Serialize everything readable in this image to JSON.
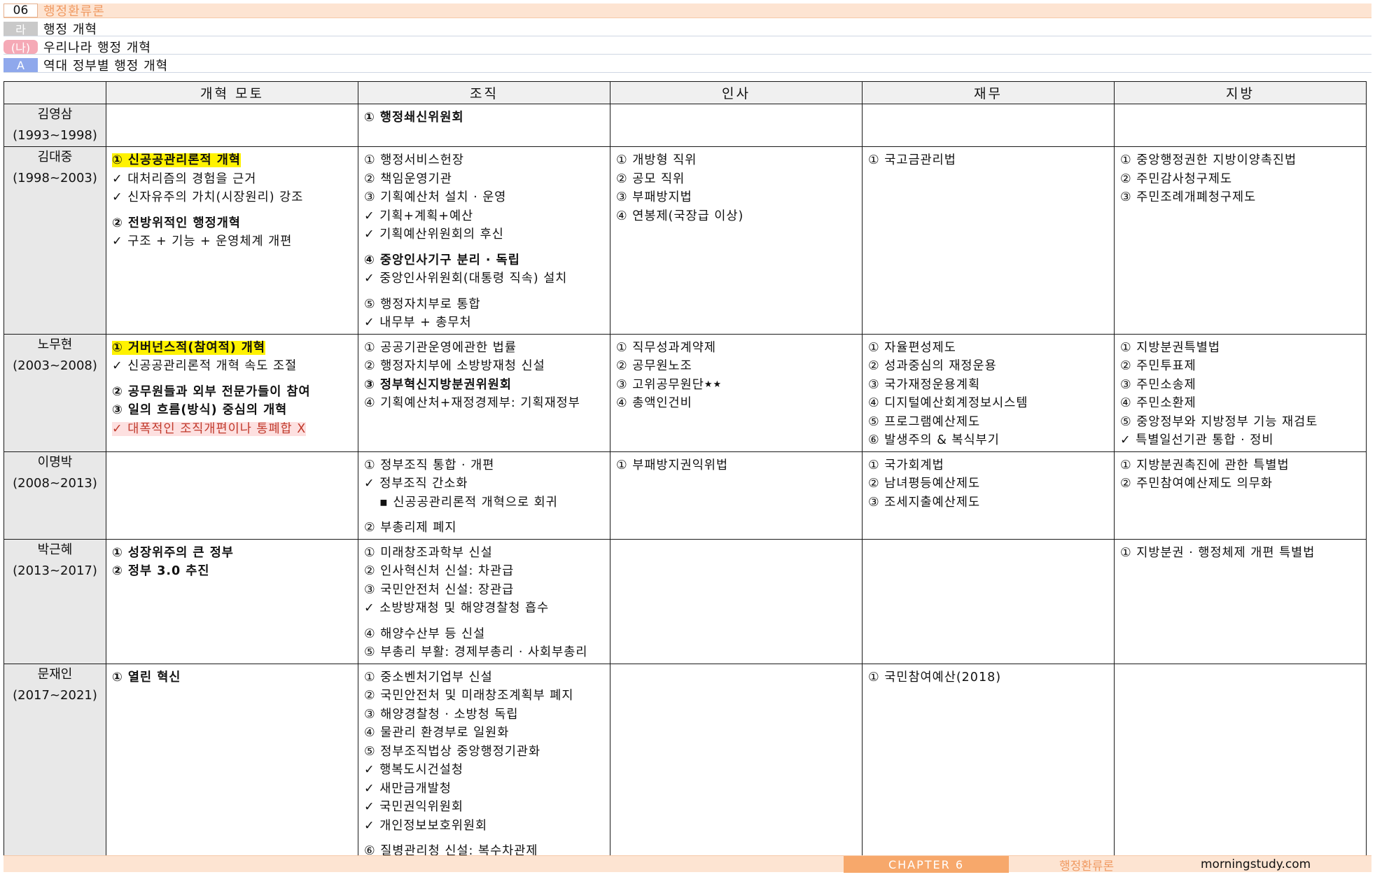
{
  "header": {
    "chapter_num": "06",
    "chapter_title": "행정환류론",
    "ra_label": "라",
    "ra_title": "행정 개혁",
    "na_label": "(나)",
    "na_title": "우리나라 행정 개혁",
    "a_label": "A",
    "a_title": "역대 정부별 행정 개혁"
  },
  "table": {
    "columns": [
      "개혁 모토",
      "조직",
      "인사",
      "재무",
      "지방"
    ],
    "rows": [
      {
        "name": "김영삼",
        "years": "(1993~1998)",
        "motto": [],
        "org": [
          {
            "t": "① 행정쇄신위원회",
            "s": "b"
          }
        ],
        "hr": [],
        "fin": [],
        "local": []
      },
      {
        "name": "김대중",
        "years": "(1998~2003)",
        "motto": [
          {
            "t": "① 신공공관리론적 개혁",
            "s": "b hl"
          },
          {
            "t": "✓ 대처리즘의 경험을 근거"
          },
          {
            "t": "✓ 신자유주의 가치(시장원리) 강조"
          },
          {
            "t": "② 전방위적인 행정개혁",
            "s": "b gap"
          },
          {
            "t": "✓ 구조 + 기능 + 운영체계 개편"
          }
        ],
        "org": [
          {
            "t": "① 행정서비스헌장"
          },
          {
            "t": "② 책임운영기관"
          },
          {
            "t": "③ 기획예산처 설치 · 운영"
          },
          {
            "t": "✓ 기획+계획+예산"
          },
          {
            "t": "✓ 기획예산위원회의 후신"
          },
          {
            "t": "④ 중앙인사기구 분리 · 독립",
            "s": "b gap"
          },
          {
            "t": "✓ 중앙인사위원회(대통령 직속) 설치"
          },
          {
            "t": "⑤ 행정자치부로 통합",
            "s": "gap"
          },
          {
            "t": "✓ 내무부 + 총무처"
          }
        ],
        "hr": [
          {
            "t": "① 개방형 직위"
          },
          {
            "t": "② 공모 직위"
          },
          {
            "t": "③ 부패방지법"
          },
          {
            "t": "④ 연봉제(국장급 이상)"
          }
        ],
        "fin": [
          {
            "t": "① 국고금관리법"
          }
        ],
        "local": [
          {
            "t": "① 중앙행정권한 지방이양촉진법"
          },
          {
            "t": "② 주민감사청구제도"
          },
          {
            "t": "③ 주민조례개폐청구제도"
          }
        ]
      },
      {
        "name": "노무현",
        "years": "(2003~2008)",
        "motto": [
          {
            "t": "① 거버넌스적(참여적) 개혁",
            "s": "b hl"
          },
          {
            "t": "✓ 신공공관리론적 개혁 속도 조절"
          },
          {
            "t": "② 공무원들과 외부 전문가들이 참여",
            "s": "b gap"
          },
          {
            "t": "③ 일의 흐름(방식) 중심의 개혁",
            "s": "b"
          },
          {
            "t": " ✓ 대폭적인 조직개편이나 통폐합 X",
            "s": "pk"
          }
        ],
        "org": [
          {
            "t": "① 공공기관운영에관한 법률"
          },
          {
            "t": "② 행정자치부에 소방방재청 신설"
          },
          {
            "t": "③ 정부혁신지방분권위원회",
            "s": "b"
          },
          {
            "t": "④ 기획예산처+재정경제부: 기획재정부"
          }
        ],
        "hr": [
          {
            "t": "① 직무성과계약제"
          },
          {
            "t": "② 공무원노조"
          },
          {
            "t": "③ 고위공무원단",
            "star": "★★"
          },
          {
            "t": "④ 총액인건비"
          }
        ],
        "fin": [
          {
            "t": "① 자율편성제도"
          },
          {
            "t": "② 성과중심의 재정운용"
          },
          {
            "t": "③ 국가재정운용계획"
          },
          {
            "t": "④ 디지털예산회계정보시스템"
          },
          {
            "t": "⑤ 프로그램예산제도"
          },
          {
            "t": "⑥ 발생주의 & 복식부기"
          }
        ],
        "local": [
          {
            "t": "① 지방분권특별법"
          },
          {
            "t": "② 주민투표제"
          },
          {
            "t": "③ 주민소송제"
          },
          {
            "t": "④ 주민소환제"
          },
          {
            "t": "⑤ 중앙정부와 지방정부 기능 재검토"
          },
          {
            "t": "✓ 특별일선기관 통합 · 정비"
          }
        ]
      },
      {
        "name": "이명박",
        "years": "(2008~2013)",
        "motto": [],
        "org": [
          {
            "t": "① 정부조직 통합 · 개편"
          },
          {
            "t": "✓ 정부조직 간소화"
          },
          {
            "t": "▪ 신공공관리론적 개혁으로 회귀",
            "s": "ind"
          },
          {
            "t": "② 부총리제 폐지",
            "s": "gap"
          }
        ],
        "hr": [
          {
            "t": "① 부패방지권익위법"
          }
        ],
        "fin": [
          {
            "t": "① 국가회계법"
          },
          {
            "t": "② 남녀평등예산제도"
          },
          {
            "t": "③ 조세지출예산제도"
          }
        ],
        "local": [
          {
            "t": "① 지방분권촉진에 관한 특별법"
          },
          {
            "t": "② 주민참여예산제도 의무화"
          }
        ]
      },
      {
        "name": "박근혜",
        "years": "(2013~2017)",
        "motto": [
          {
            "t": "① 성장위주의 큰 정부",
            "s": "b"
          },
          {
            "t": "② 정부 3.0 추진",
            "s": "b"
          }
        ],
        "org": [
          {
            "t": "① 미래창조과학부 신설"
          },
          {
            "t": "② 인사혁신처 신설: 차관급"
          },
          {
            "t": "③ 국민안전처 신설: 장관급"
          },
          {
            "t": "✓ 소방방재청 및 해양경찰청 흡수"
          },
          {
            "t": "④ 해양수산부 등 신설",
            "s": "gap"
          },
          {
            "t": "⑤ 부총리 부활: 경제부총리 · 사회부총리"
          }
        ],
        "hr": [],
        "fin": [],
        "local": [
          {
            "t": "① 지방분권 · 행정체제 개편 특별법"
          }
        ]
      },
      {
        "name": "문재인",
        "years": "(2017~2021)",
        "motto": [
          {
            "t": "① 열린 혁신",
            "s": "b"
          }
        ],
        "org": [
          {
            "t": "① 중소벤처기업부 신설"
          },
          {
            "t": "② 국민안전처 및 미래창조계획부 폐지"
          },
          {
            "t": "③ 해양경찰청 · 소방청 독립"
          },
          {
            "t": "④ 물관리 환경부로 일원화"
          },
          {
            "t": "⑤ 정부조직법상 중앙행정기관화"
          },
          {
            "t": "✓ 행복도시건설청"
          },
          {
            "t": "✓ 새만금개발청"
          },
          {
            "t": "✓ 국민권익위원회"
          },
          {
            "t": "✓ 개인정보보호위원회"
          },
          {
            "t": "⑥ 질병관리청 신설: 복수차관제",
            "s": "gap"
          }
        ],
        "hr": [],
        "fin": [
          {
            "t": "① 국민참여예산(2018)"
          }
        ],
        "local": []
      }
    ]
  },
  "footer": {
    "chapter": "CHAPTER 6",
    "title": "행정환류론",
    "site": "morningstudy.com"
  },
  "colors": {
    "header_bg": "#fde4d2",
    "accent_orange": "#f09a62",
    "highlight_yellow": "#fff200",
    "highlight_pink": "#fde0e0",
    "row_label_bg": "#e8e8e8",
    "label_blue": "#8fa8ec",
    "label_pink": "#f5a9b6"
  }
}
